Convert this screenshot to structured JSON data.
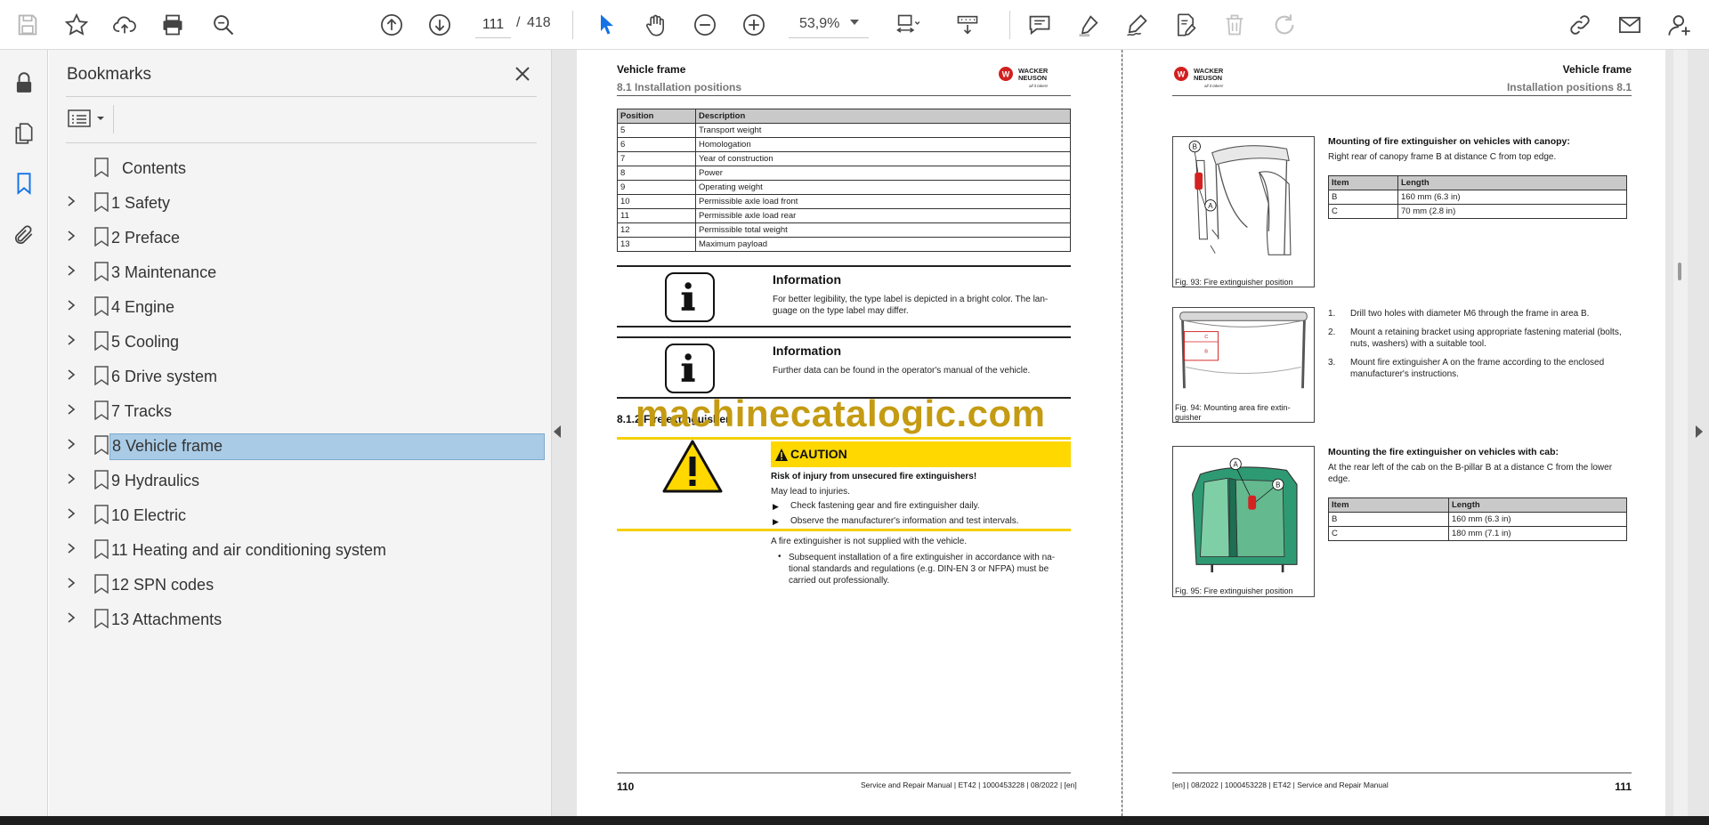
{
  "toolbar": {
    "page_current": "111",
    "page_sep": "/",
    "page_total": "418",
    "zoom": "53,9%"
  },
  "bookmarks": {
    "title": "Bookmarks",
    "items": [
      {
        "label": "Contents"
      },
      {
        "label": "1 Safety"
      },
      {
        "label": "2 Preface"
      },
      {
        "label": "3 Maintenance"
      },
      {
        "label": "4 Engine"
      },
      {
        "label": "5 Cooling"
      },
      {
        "label": "6 Drive system"
      },
      {
        "label": "7 Tracks"
      },
      {
        "label": "8 Vehicle frame"
      },
      {
        "label": "9 Hydraulics"
      },
      {
        "label": "10 Electric"
      },
      {
        "label": "11 Heating and air conditioning system"
      },
      {
        "label": "12 SPN codes"
      },
      {
        "label": "13 Attachments"
      }
    ],
    "selected_index": 8
  },
  "left_page": {
    "title": "Vehicle frame",
    "subtitle": "8.1 Installation positions",
    "table": {
      "headers": [
        "Position",
        "Description"
      ],
      "rows": [
        [
          "5",
          "Transport weight"
        ],
        [
          "6",
          "Homologation"
        ],
        [
          "7",
          "Year of construction"
        ],
        [
          "8",
          "Power"
        ],
        [
          "9",
          "Operating weight"
        ],
        [
          "10",
          "Permissible axle load front"
        ],
        [
          "11",
          "Permissible axle load rear"
        ],
        [
          "12",
          "Permissible total weight"
        ],
        [
          "13",
          "Maximum payload"
        ]
      ]
    },
    "info1": {
      "title": "Information",
      "text": "For better legibility, the type label is depicted in a bright color. The lan-guage on the type label may differ."
    },
    "info2": {
      "title": "Information",
      "text": "Further data can be found in the operator's manual of the vehicle."
    },
    "section_heading": "8.1.2 Fire extinguisher",
    "caution": {
      "label": "CAUTION",
      "heading": "Risk of injury from unsecured fire extinguishers!",
      "lead": "May lead to injuries.",
      "bullets": [
        "Check fastening gear and fire extinguisher daily.",
        "Observe the manufacturer's information and test intervals."
      ]
    },
    "note": "A fire extinguisher is not supplied with the vehicle.",
    "note_bullet": "Subsequent installation of a fire extinguisher in accordance with na-tional standards and regulations (e.g. DIN-EN 3 or NFPA) must be carried out professionally.",
    "page_number": "110",
    "footer": "Service and Repair Manual | ET42 | 1000453228 | 08/2022 | [en]"
  },
  "right_page": {
    "title": "Vehicle frame",
    "subtitle": "Installation positions 8.1",
    "canopy": {
      "heading": "Mounting of fire extinguisher on vehicles with canopy:",
      "text": "Right rear of canopy frame B at distance C from top edge.",
      "table_headers": [
        "Item",
        "Length"
      ],
      "table_rows": [
        [
          "B",
          "160 mm (6.3 in)"
        ],
        [
          "C",
          "70 mm (2.8 in)"
        ]
      ]
    },
    "fig93": "Fig. 93: Fire extinguisher position",
    "fig94": "Fig. 94: Mounting area fire extin-guisher",
    "fig95": "Fig. 95: Fire extinguisher position",
    "steps": [
      {
        "num": "1.",
        "text": "Drill two holes with diameter M6 through the frame in area B."
      },
      {
        "num": "2.",
        "text": "Mount a retaining bracket using appropriate fastening material (bolts, nuts, washers) with a suitable tool."
      },
      {
        "num": "3.",
        "text": "Mount fire extinguisher A on the frame according to the enclosed manufacturer's instructions."
      }
    ],
    "cab": {
      "heading": "Mounting the fire extinguisher on vehicles with cab:",
      "text": "At the rear left of the cab on the B-pillar B at a distance C from the lower edge.",
      "table_headers": [
        "Item",
        "Length"
      ],
      "table_rows": [
        [
          "B",
          "160 mm (6.3 in)"
        ],
        [
          "C",
          "180 mm (7.1 in)"
        ]
      ]
    },
    "page_number": "111",
    "footer": "[en] | 08/2022 | 1000453228 | ET42 | Service and Repair Manual"
  },
  "logo_text": {
    "line1": "WACKER",
    "line2": "NEUSON",
    "tag": "all it takes!"
  },
  "fig_labels": {
    "a": "A",
    "b": "B",
    "c": "C"
  },
  "watermark": "machinecatalogic.com",
  "colors": {
    "selection": "#a9cbe6",
    "caution_yellow": "#ffd800",
    "watermark": "#c49b12",
    "active_tool": "#1473e6"
  }
}
